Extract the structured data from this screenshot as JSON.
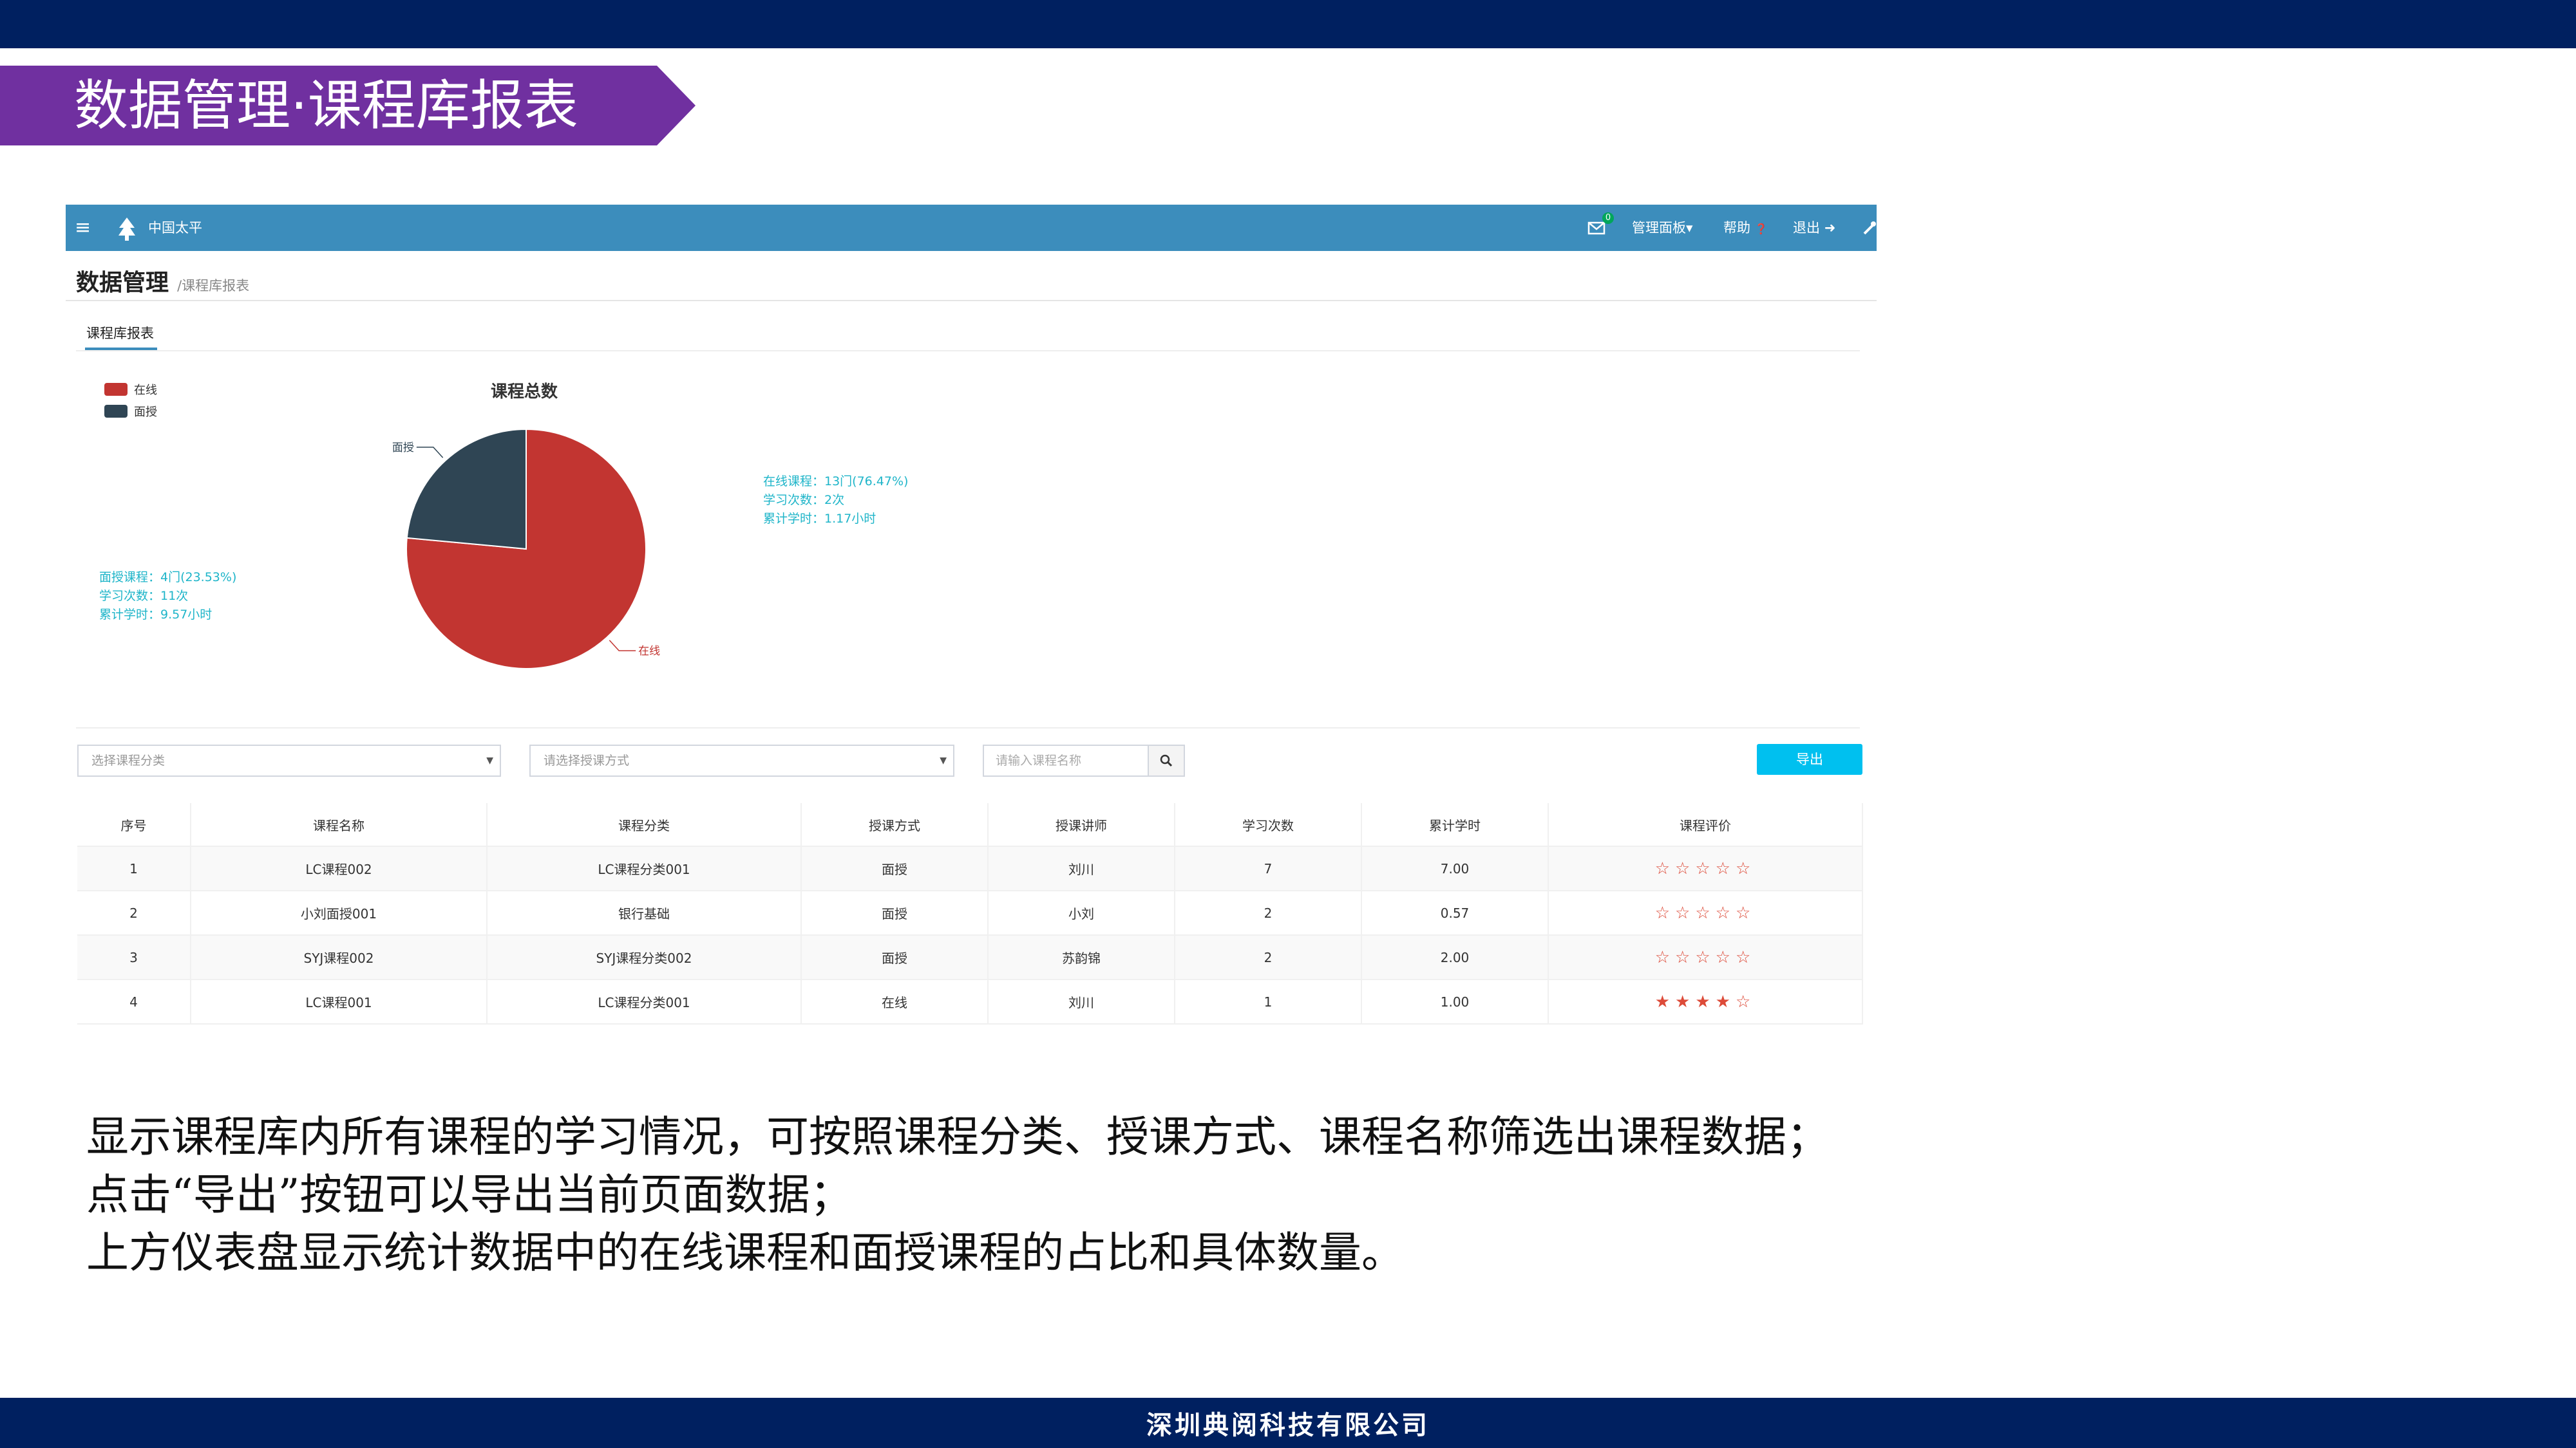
{
  "slide": {
    "title": "数据管理·课程库报表",
    "footer": "深圳典阅科技有限公司",
    "description": [
      "显示课程库内所有课程的学习情况，可按照课程分类、授课方式、课程名称筛选出课程数据；",
      "点击“导出”按钮可以导出当前页面数据；",
      "上方仪表盘显示统计数据中的在线课程和面授课程的占比和具体数量。"
    ],
    "colors": {
      "band": "#002060",
      "banner": "#7030a0"
    }
  },
  "app": {
    "brand": "中国太平",
    "icons": {
      "menu": "hamburger-icon",
      "logo": "tree-icon",
      "mail": "envelope-icon",
      "tool": "wrench-icon"
    },
    "mail_badge": "0",
    "nav": {
      "dashboard": "管理面板",
      "dashboard_caret": "▾",
      "help": "帮助",
      "help_icon": "❓",
      "logout": "退出",
      "logout_icon": "➜"
    },
    "page_title": "数据管理",
    "breadcrumb": "/课程库报表",
    "tab": "课程库报表",
    "filters": {
      "category_placeholder": "选择课程分类",
      "mode_placeholder": "请选择授课方式",
      "name_placeholder": "请输入课程名称",
      "search_icon": "search-icon",
      "export_label": "导出"
    },
    "table": {
      "headers": [
        "序号",
        "课程名称",
        "课程分类",
        "授课方式",
        "授课讲师",
        "学习次数",
        "累计学时",
        "课程评价"
      ],
      "rows": [
        {
          "no": "1",
          "name": "LC课程002",
          "category": "LC课程分类001",
          "mode": "面授",
          "teacher": "刘川",
          "count": "7",
          "hours": "7.00",
          "rating": 0
        },
        {
          "no": "2",
          "name": "小刘面授001",
          "category": "银行基础",
          "mode": "面授",
          "teacher": "小刘",
          "count": "2",
          "hours": "0.57",
          "rating": 0
        },
        {
          "no": "3",
          "name": "SYJ课程002",
          "category": "SYJ课程分类002",
          "mode": "面授",
          "teacher": "苏韵锦",
          "count": "2",
          "hours": "2.00",
          "rating": 0
        },
        {
          "no": "4",
          "name": "LC课程001",
          "category": "LC课程分类001",
          "mode": "在线",
          "teacher": "刘川",
          "count": "1",
          "hours": "1.00",
          "rating": 4
        }
      ]
    }
  },
  "chart_data": {
    "type": "pie",
    "title": "课程总数",
    "legend": [
      "在线",
      "面授"
    ],
    "legend_position": "top-left",
    "slices": [
      {
        "label": "在线",
        "value": 13,
        "percent": 76.47,
        "color": "#c23531"
      },
      {
        "label": "面授",
        "value": 4,
        "percent": 23.53,
        "color": "#2f4554"
      }
    ],
    "annotations": {
      "online": [
        "在线课程：13门(76.47%)",
        "学习次数：2次",
        "累计学时：1.17小时"
      ],
      "face": [
        "面授课程：4门(23.53%)",
        "学习次数：11次",
        "累计学时：9.57小时"
      ]
    }
  }
}
